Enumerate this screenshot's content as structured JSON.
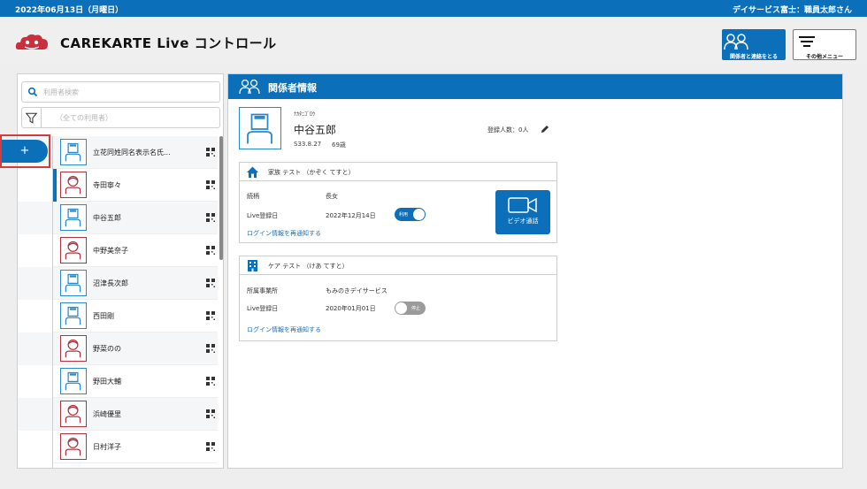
{
  "topbar": {
    "date": "2022年06月13日（月曜日）",
    "user": "デイサービス富士：職員太郎さん"
  },
  "header": {
    "app_title": "CAREKARTE Live コントロール",
    "contact_button": "関係者と連絡をとる",
    "menu_button": "その他メニュー"
  },
  "colors": {
    "primary": "#0b6fba",
    "male_border": "#2a8ad0",
    "female_border": "#b2323d",
    "highlight": "#d33c3c",
    "logo_red": "#c9303e"
  },
  "search": {
    "placeholder": "利用者検索",
    "filter_placeholder": "（全ての利用者）"
  },
  "sidebar": {
    "add_label": "+"
  },
  "users": [
    {
      "name": "立花同姓同名表示名氏...",
      "gender": "male"
    },
    {
      "name": "寺田寧々",
      "gender": "female"
    },
    {
      "name": "中谷五郎",
      "gender": "male"
    },
    {
      "name": "中野美奈子",
      "gender": "female"
    },
    {
      "name": "沼津長次郎",
      "gender": "male"
    },
    {
      "name": "西田剛",
      "gender": "male"
    },
    {
      "name": "野菜のの",
      "gender": "female"
    },
    {
      "name": "野田大輔",
      "gender": "male"
    },
    {
      "name": "浜崎優里",
      "gender": "female"
    },
    {
      "name": "日村洋子",
      "gender": "female"
    }
  ],
  "main": {
    "title": "関係者情報",
    "profile": {
      "kana": "ﾅｶﾀﾆｺﾞﾛｳ",
      "name": "中谷五郎",
      "birth": "S33.8.27",
      "age": "69歳",
      "reg_count": "登録人数：0人"
    },
    "family_card": {
      "title": "家族 テスト （かぞく てすと）",
      "relation_label": "続柄",
      "relation_value": "長女",
      "live_date_label": "Live登録日",
      "live_date_value": "2022年12月14日",
      "toggle_label": "利用",
      "link": "ログイン情報を再通知する",
      "video_label": "ビデオ通話"
    },
    "care_card": {
      "title": "ケア テスト （けあ てすと）",
      "office_label": "所属事業所",
      "office_value": "もみのきデイサービス",
      "live_date_label": "Live登録日",
      "live_date_value": "2020年01月01日",
      "toggle_label": "停止",
      "link": "ログイン情報を再通知する"
    }
  }
}
